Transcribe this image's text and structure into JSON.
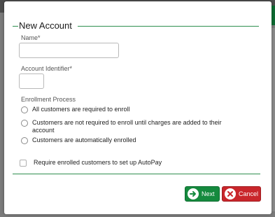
{
  "dialog": {
    "title": "New Account",
    "name_label": "Name*",
    "name_value": "",
    "identifier_label": "Account Identifier*",
    "identifier_value": "",
    "enrollment_label": "Enrollment Process",
    "enrollment_options": [
      "All customers are required to enroll",
      "Customers are not required to enroll until charges are added to their account",
      "Customers are automatically enrolled"
    ],
    "autopay_label": "Require enrolled customers to set up AutoPay",
    "next_label": "Next",
    "cancel_label": "Cancel"
  },
  "colors": {
    "accent_green": "#158a3e",
    "cancel_red": "#c9262b",
    "rule_green": "#2f8f4f"
  },
  "icons": {
    "next": "arrow-right-circle-icon",
    "cancel": "x-circle-icon"
  }
}
